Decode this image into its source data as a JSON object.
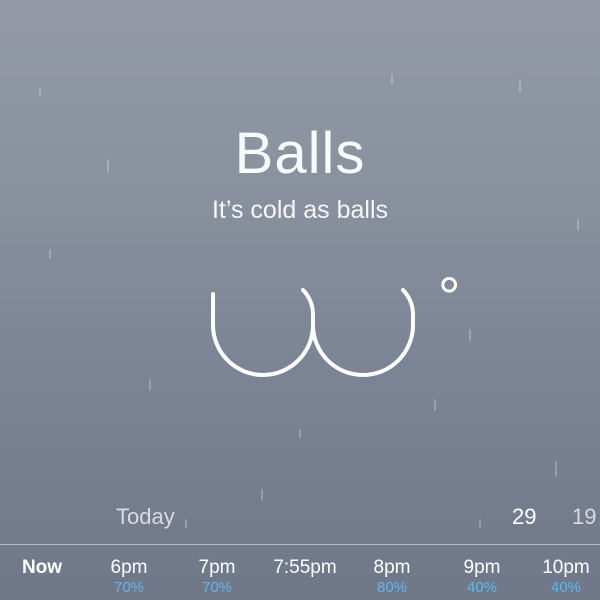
{
  "location": "Balls",
  "condition": "It’s cold as balls",
  "temperature_icon": "balls-shaped-temperature-glyph",
  "degree_symbol": "°",
  "today": {
    "label": "Today",
    "high": "29",
    "low": "19"
  },
  "hourly": [
    {
      "time": "Now",
      "chance": ""
    },
    {
      "time": "6pm",
      "chance": "70%"
    },
    {
      "time": "7pm",
      "chance": "70%"
    },
    {
      "time": "7:55pm",
      "chance": ""
    },
    {
      "time": "8pm",
      "chance": "80%"
    },
    {
      "time": "9pm",
      "chance": "40%"
    },
    {
      "time": "10pm",
      "chance": "40%"
    }
  ],
  "colors": {
    "background_top": "#939aa6",
    "background_bottom": "#6f7889",
    "text": "#ffffff",
    "precip_chance": "#5fb7ec"
  }
}
